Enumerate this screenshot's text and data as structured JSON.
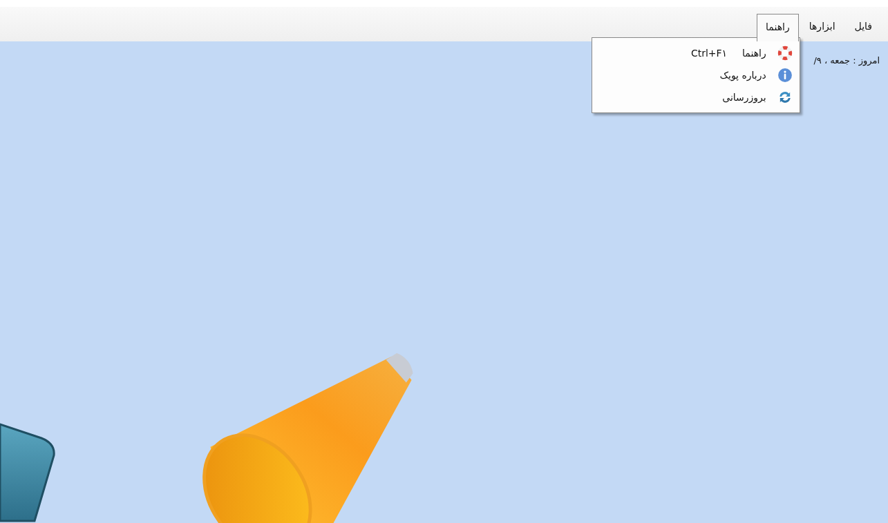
{
  "menubar": {
    "items": [
      {
        "label": "فایل",
        "selected": false
      },
      {
        "label": "ابزارها",
        "selected": false
      },
      {
        "label": "راهنما",
        "selected": true
      }
    ]
  },
  "dropdown": {
    "items": [
      {
        "label": "راهنما",
        "shortcut": "Ctrl+F۱",
        "kind": "lifebuoy"
      },
      {
        "label": "درباره پویک",
        "kind": "info"
      },
      {
        "label": "بروزرسانی",
        "kind": "refresh"
      }
    ]
  },
  "today_label": "امروز : جمعه ، ۹/"
}
